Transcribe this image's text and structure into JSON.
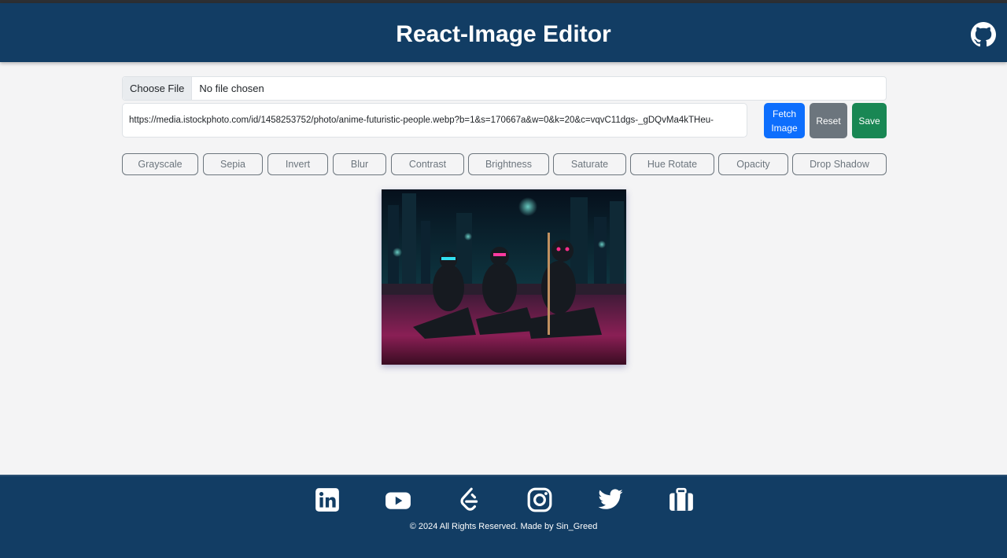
{
  "header": {
    "title": "React-Image Editor",
    "github_icon": "github-icon"
  },
  "upload": {
    "button_label": "Choose File",
    "status": "No file chosen"
  },
  "url_input": {
    "value": "https://media.istockphoto.com/id/1458253752/photo/anime-futuristic-people.webp?b=1&s=170667a&w=0&k=20&c=vqvC11dgs-_gDQvMa4kTHeu-"
  },
  "actions": {
    "fetch": "Fetch Image",
    "reset": "Reset",
    "save": "Save"
  },
  "filters": [
    "Grayscale",
    "Sepia",
    "Invert",
    "Blur",
    "Contrast",
    "Brightness",
    "Saturate",
    "Hue Rotate",
    "Opacity",
    "Drop Shadow"
  ],
  "footer": {
    "icons": [
      "linkedin-icon",
      "youtube-icon",
      "leetcode-icon",
      "instagram-icon",
      "twitter-icon",
      "portfolio-icon"
    ],
    "copyright": "© 2024 All Rights Reserved. Made by Sin_Greed"
  },
  "colors": {
    "header_bg": "#123d64",
    "primary": "#0d6efd",
    "secondary": "#6c757d",
    "success": "#198754"
  }
}
